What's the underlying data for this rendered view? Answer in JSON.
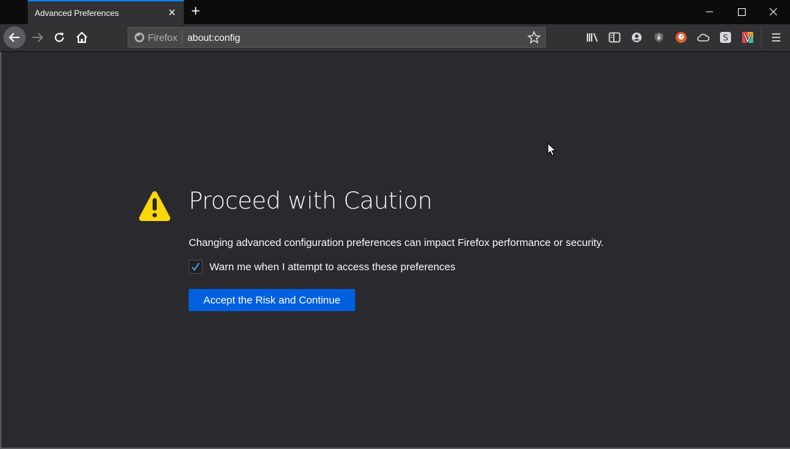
{
  "window": {
    "tab_title": "Advanced Preferences",
    "tab_close": "×",
    "new_tab": "+",
    "controls": [
      "minimize",
      "maximize",
      "close"
    ]
  },
  "toolbar": {
    "identity_label": "Firefox",
    "url": "about:config",
    "icons": [
      "library-icon",
      "sidebar-icon",
      "account-icon",
      "privacy-shield-icon",
      "duckduckgo-icon",
      "cloud-icon",
      "s-extension-icon",
      "v-extension-icon",
      "menu-icon"
    ]
  },
  "page": {
    "title": "Proceed with Caution",
    "description": "Changing advanced configuration preferences can impact Firefox performance or security.",
    "checkbox_label": "Warn me when I attempt to access these preferences",
    "checkbox_checked": true,
    "accept_button": "Accept the Risk and Continue"
  },
  "colors": {
    "accent": "#0a84ff",
    "button": "#0060df",
    "warning": "#ffd60a",
    "background": "#2a2a2e"
  }
}
